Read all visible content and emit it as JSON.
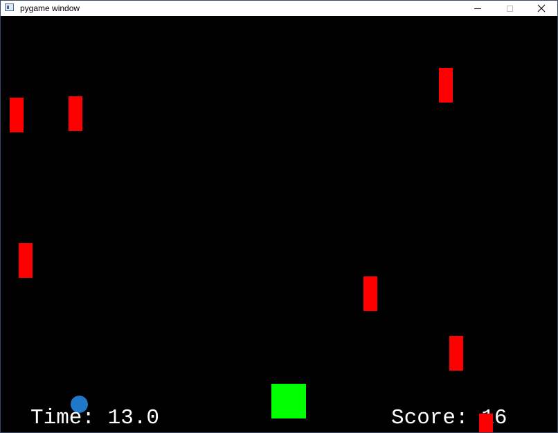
{
  "window": {
    "title": "pygame window",
    "icon": "pygame-app-icon",
    "controls": {
      "minimize_icon": "minimize-icon",
      "maximize_icon": "maximize-icon",
      "close_icon": "close-icon"
    }
  },
  "game": {
    "background_color": "#000000",
    "obstacle_color": "#ff0000",
    "player_color": "#00ff00",
    "ball_color": "#1f78c8",
    "time_text": "Time: 13.0",
    "score_text": "Score: 16"
  }
}
